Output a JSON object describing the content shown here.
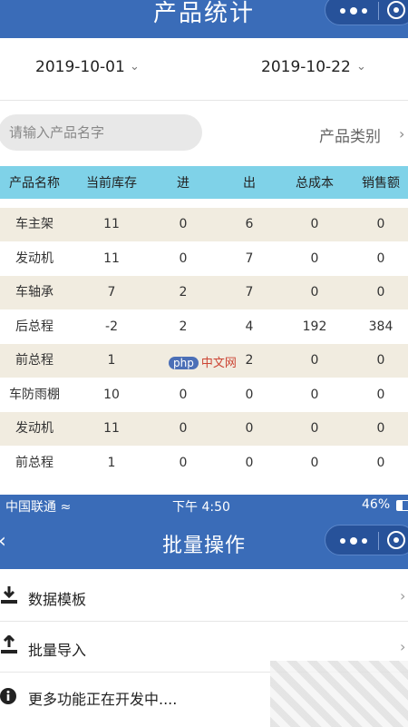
{
  "stats_page": {
    "title": "产品统计",
    "start_date": "2019-10-01",
    "end_date": "2019-10-22",
    "search_placeholder": "请输入产品名字",
    "category_label": "产品类别",
    "columns": [
      "产品名称",
      "当前库存",
      "进",
      "出",
      "总成本",
      "销售额"
    ],
    "rows": [
      [
        "车主架",
        "11",
        "0",
        "6",
        "0",
        "0"
      ],
      [
        "发动机",
        "11",
        "0",
        "7",
        "0",
        "0"
      ],
      [
        "车轴承",
        "7",
        "2",
        "7",
        "0",
        "0"
      ],
      [
        "后总程",
        "-2",
        "2",
        "4",
        "192",
        "384"
      ],
      [
        "前总程",
        "1",
        "",
        "2",
        "0",
        "0"
      ],
      [
        "车防雨棚",
        "10",
        "0",
        "0",
        "0",
        "0"
      ],
      [
        "发动机",
        "11",
        "0",
        "0",
        "0",
        "0"
      ],
      [
        "前总程",
        "1",
        "0",
        "0",
        "0",
        "0"
      ]
    ],
    "row_colors": [
      "#f1ece0",
      "#ffffff"
    ],
    "header_color": "#7fd2e8",
    "watermark": {
      "badge": "php",
      "text": "中文网"
    }
  },
  "status_bar": {
    "carrier": "中国联通",
    "time": "下午 4:50",
    "battery": "46%"
  },
  "batch_page": {
    "title": "批量操作",
    "items": [
      {
        "label": "数据模板",
        "icon": "download-icon"
      },
      {
        "label": "批量导入",
        "icon": "upload-icon"
      },
      {
        "label": "更多功能正在开发中....",
        "icon": "info-icon"
      }
    ]
  },
  "colors": {
    "nav_blue": "#3a6cb8"
  }
}
